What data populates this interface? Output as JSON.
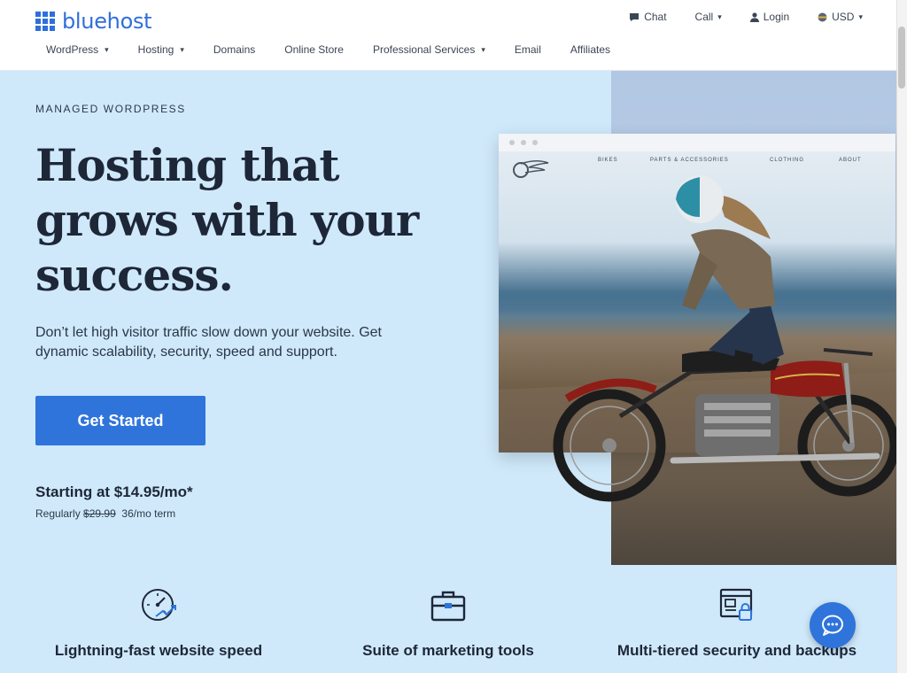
{
  "brand": {
    "name": "bluehost",
    "color": "#2f6fdb"
  },
  "utility": [
    {
      "icon": "chat-icon",
      "label": "Chat",
      "caret": false
    },
    {
      "icon": "",
      "label": "Call",
      "caret": true
    },
    {
      "icon": "user-icon",
      "label": "Login",
      "caret": false
    },
    {
      "icon": "globe-icon",
      "label": "USD",
      "caret": true
    }
  ],
  "nav": [
    {
      "label": "WordPress",
      "caret": true
    },
    {
      "label": "Hosting",
      "caret": true
    },
    {
      "label": "Domains",
      "caret": false
    },
    {
      "label": "Online Store",
      "caret": false
    },
    {
      "label": "Professional Services",
      "caret": true
    },
    {
      "label": "Email",
      "caret": false
    },
    {
      "label": "Affiliates",
      "caret": false
    }
  ],
  "hero": {
    "eyebrow": "MANAGED WORDPRESS",
    "headline": "Hosting that grows with your success.",
    "subtext": "Don’t let high visitor traffic slow down your website. Get dynamic scalability, security, speed and support.",
    "cta": "Get Started",
    "price": "Starting at $14.95/mo*",
    "regular_prefix": "Regularly",
    "regular_price": "$29.99",
    "term": "36/mo term"
  },
  "demo_site": {
    "nav": [
      "BIKES",
      "PARTS & ACCESSORIES",
      "CLOTHING",
      "ABOUT"
    ]
  },
  "features": [
    {
      "icon": "speedometer-icon",
      "title": "Lightning-fast website speed"
    },
    {
      "icon": "briefcase-icon",
      "title": "Suite of marketing tools"
    },
    {
      "icon": "secure-browser-icon",
      "title": "Multi-tiered security and backups"
    }
  ],
  "colors": {
    "accent": "#2f74db",
    "hero_bg": "#cfe9fb",
    "text_dark": "#1d2738"
  }
}
